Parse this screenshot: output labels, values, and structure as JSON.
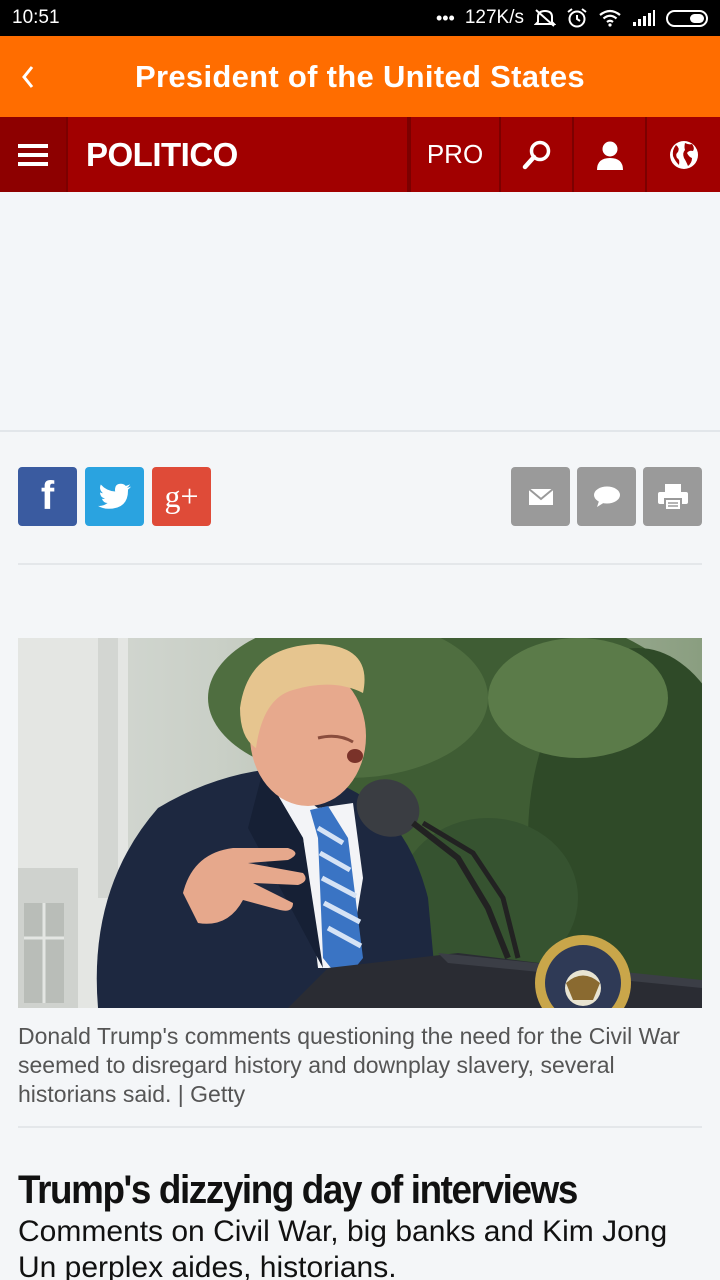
{
  "status_bar": {
    "time": "10:51",
    "network_speed": "127K/s",
    "icons": [
      "more-dots-icon",
      "mute-icon",
      "alarm-icon",
      "wifi-icon",
      "signal-icon",
      "battery-icon"
    ]
  },
  "title_bar": {
    "back_icon": "chevron-left-icon",
    "title": "President of the United States",
    "color": "#ff6d00"
  },
  "politico_header": {
    "logo": "POLITICO",
    "pro_label": "PRO",
    "icons": [
      "hamburger-menu-icon",
      "search-icon",
      "user-icon",
      "globe-icon"
    ],
    "color": "#a10000"
  },
  "share": {
    "buttons": [
      {
        "name": "facebook",
        "label": "f",
        "color": "#3a5ba0"
      },
      {
        "name": "twitter",
        "color": "#2aa3e0"
      },
      {
        "name": "google-plus",
        "label": "g+",
        "color": "#df4b38"
      },
      {
        "name": "email",
        "color": "#9a9a9a"
      },
      {
        "name": "comment",
        "color": "#9a9a9a"
      },
      {
        "name": "print",
        "color": "#9a9a9a"
      }
    ]
  },
  "article": {
    "caption": "Donald Trump's comments questioning the need for the Civil War seemed to disregard history and downplay slavery, several historians said. | Getty",
    "headline": "Trump's dizzying day of interviews",
    "subhead": "Comments on Civil War, big banks and Kim Jong Un perplex aides, historians."
  }
}
